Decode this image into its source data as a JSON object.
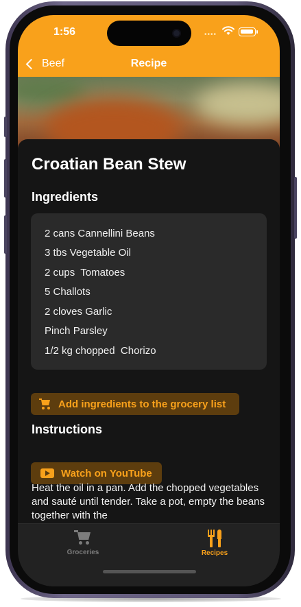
{
  "status_bar": {
    "time": "1:56"
  },
  "nav": {
    "back_label": "Beef",
    "title": "Recipe"
  },
  "recipe": {
    "title": "Croatian Bean Stew",
    "ingredients_heading": "Ingredients",
    "ingredients": [
      "2 cans Cannellini Beans",
      "3 tbs Vegetable Oil",
      "2 cups  Tomatoes",
      "5 Challots",
      "2 cloves Garlic",
      "Pinch Parsley",
      "1/2 kg chopped  Chorizo"
    ],
    "add_to_grocery_label": "Add ingredients to the grocery list",
    "instructions_heading": "Instructions",
    "youtube_label": "Watch on YouTube",
    "instructions_text": "Heat the oil in a pan. Add the chopped vegetables and sauté until tender. Take a pot, empty the beans together with the"
  },
  "tabbar": {
    "tabs": [
      {
        "label": "Groceries",
        "icon": "cart-icon",
        "selected": false
      },
      {
        "label": "Recipes",
        "icon": "fork-knife-icon",
        "selected": true
      }
    ]
  },
  "colors": {
    "accent": "#f9a11b",
    "sheet": "#151515",
    "ingredient_box": "#2a2a2a",
    "tabbar": "#222222"
  }
}
